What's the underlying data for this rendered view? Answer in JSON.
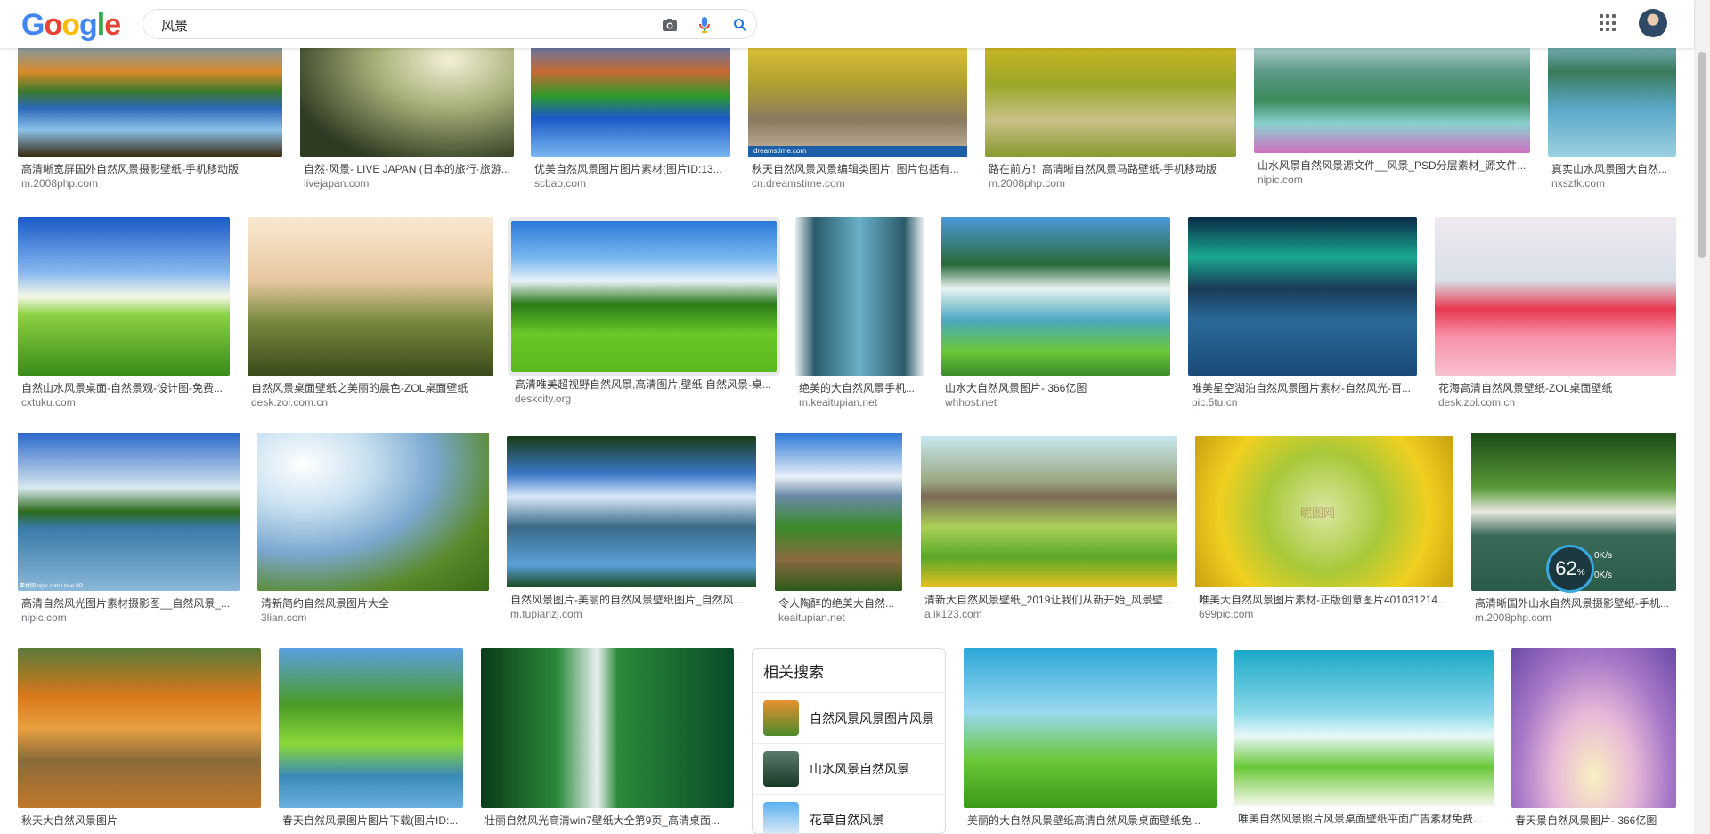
{
  "search": {
    "query": "风景"
  },
  "colors": {
    "accent": "#1a73e8",
    "caption": "#3c4043",
    "source": "#70757a"
  },
  "row1": [
    {
      "cap": "高清晰宽屏国外自然风景摄影壁纸-手机移动版",
      "src": "m.2008php.com"
    },
    {
      "cap": "自然·风景- LIVE JAPAN (日本的旅行·旅游...",
      "src": "livejapan.com"
    },
    {
      "cap": "优美自然风景图片图片素材(图片ID:13...",
      "src": "scbao.com"
    },
    {
      "cap": "秋天自然风景风景编辑类图片. 图片包括有...",
      "src": "cn.dreamstime.com"
    },
    {
      "cap": "路在前方！高清晰自然风景马路壁纸-手机移动版",
      "src": "m.2008php.com"
    },
    {
      "cap": "山水风景自然风景源文件__风景_PSD分层素材_源文件...",
      "src": "nipic.com"
    },
    {
      "cap": "真实山水风景图大自然...",
      "src": "nxszfk.com"
    }
  ],
  "row2": [
    {
      "cap": "自然山水风景桌面-自然景观-设计图-免费...",
      "src": "cxtuku.com"
    },
    {
      "cap": "自然风景桌面壁纸之美丽的晨色-ZOL桌面壁纸",
      "src": "desk.zol.com.cn"
    },
    {
      "cap": "高清唯美超视野自然风景,高清图片,壁纸,自然风景-桌...",
      "src": "deskcity.org"
    },
    {
      "cap": "绝美的大自然风景手机...",
      "src": "m.keaitupian.net"
    },
    {
      "cap": "山水大自然风景图片- 366亿图",
      "src": "whhost.net"
    },
    {
      "cap": "唯美星空湖泊自然风景图片素材-自然风光-百...",
      "src": "pic.5tu.cn"
    },
    {
      "cap": "花海高清自然风景壁纸-ZOL桌面壁纸",
      "src": "desk.zol.com.cn"
    }
  ],
  "row3": [
    {
      "cap": "高清自然风光图片素材摄影图__自然风景_...",
      "src": "nipic.com"
    },
    {
      "cap": "清新简约自然风景图片大全",
      "src": "3lian.com"
    },
    {
      "cap": "自然风景图片-美丽的自然风景壁纸图片_自然风...",
      "src": "m.tupianzj.com"
    },
    {
      "cap": "令人陶醉的绝美大自然...",
      "src": "keaitupian.net"
    },
    {
      "cap": "清新大自然风景壁纸_2019让我们从新开始_风景壁...",
      "src": "a.ik123.com"
    },
    {
      "cap": "唯美大自然风景图片素材-正版创意图片401031214...",
      "src": "699pic.com"
    },
    {
      "cap": "高清晰国外山水自然风景摄影壁纸-手机...",
      "src": "m.2008php.com"
    }
  ],
  "row4": [
    {
      "cap": "秋天大自然风景图片",
      "src": ""
    },
    {
      "cap": "春天自然风景图片图片下载(图片ID:...",
      "src": ""
    },
    {
      "cap": "壮丽自然风光高清win7壁纸大全第9页_高清桌面...",
      "src": ""
    },
    {
      "cap": "美丽的大自然风景壁纸高清自然风景桌面壁纸免...",
      "src": ""
    },
    {
      "cap": "唯美自然风景照片风景桌面壁纸平面广告素材免费...",
      "src": ""
    },
    {
      "cap": "春天景自然风景图片- 366亿图",
      "src": ""
    }
  ],
  "related": {
    "title": "相关搜索",
    "items": [
      {
        "label": "自然风景风景图片风景"
      },
      {
        "label": "山水风景自然风景"
      },
      {
        "label": "花草自然风景"
      }
    ]
  },
  "watermarks": {
    "r1_4": "dreamstime.com",
    "r3_1": "素材网 nipic.com / blue.PP",
    "r3_6": "昵图网"
  },
  "speed_widget": {
    "percent": "62",
    "unit": "%",
    "up": "0K/s",
    "down": "0K/s"
  }
}
